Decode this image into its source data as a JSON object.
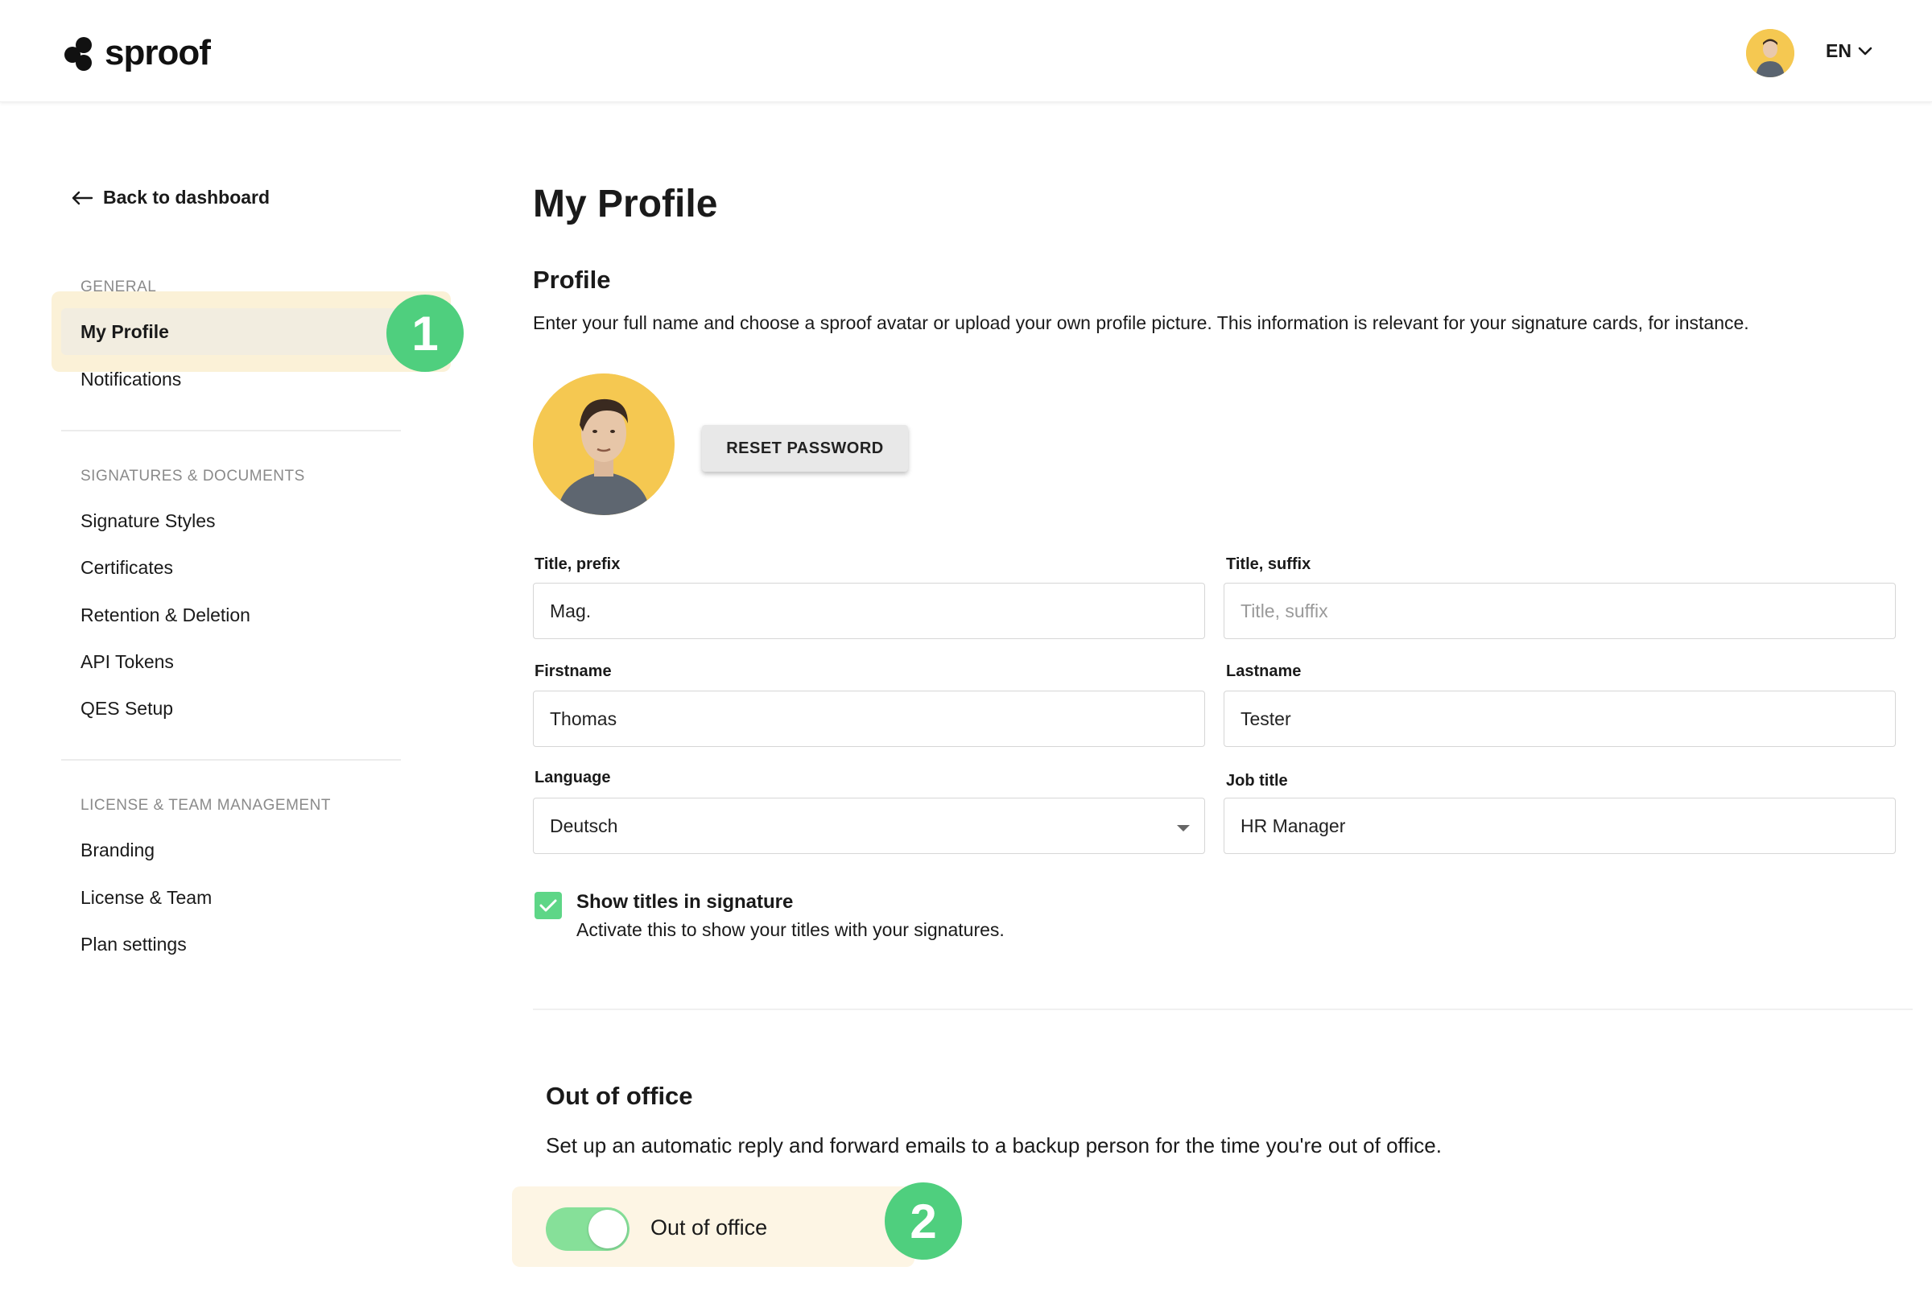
{
  "header": {
    "logo_text": "sproof",
    "language": "EN"
  },
  "sidebar": {
    "back_label": "Back to dashboard",
    "sections": [
      {
        "label": "GENERAL",
        "items": [
          "My Profile",
          "Notifications"
        ]
      },
      {
        "label": "SIGNATURES & DOCUMENTS",
        "items": [
          "Signature Styles",
          "Certificates",
          "Retention & Deletion",
          "API Tokens",
          "QES Setup"
        ]
      },
      {
        "label": "LICENSE & TEAM MANAGEMENT",
        "items": [
          "Branding",
          "License & Team",
          "Plan settings"
        ]
      }
    ],
    "active_item": "My Profile"
  },
  "badges": {
    "step1": "1",
    "step2": "2"
  },
  "main": {
    "page_title": "My Profile",
    "profile": {
      "heading": "Profile",
      "description": "Enter your full name and choose a sproof avatar or upload your own profile picture. This information is relevant for your signature cards, for instance.",
      "reset_password": "RESET PASSWORD"
    },
    "form": {
      "title_prefix": {
        "label": "Title, prefix",
        "value": "Mag.",
        "placeholder": "Title, prefix"
      },
      "title_suffix": {
        "label": "Title, suffix",
        "value": "",
        "placeholder": "Title, suffix"
      },
      "firstname": {
        "label": "Firstname",
        "value": "Thomas"
      },
      "lastname": {
        "label": "Lastname",
        "value": "Tester"
      },
      "language": {
        "label": "Language",
        "value": "Deutsch"
      },
      "job_title": {
        "label": "Job title",
        "value": "HR Manager"
      }
    },
    "show_titles": {
      "checked": true,
      "title": "Show titles in signature",
      "subtitle": "Activate this to show your titles with your signatures."
    },
    "out_of_office": {
      "heading": "Out of office",
      "description": "Set up an automatic reply and forward emails to a backup person for the time you're out of office.",
      "toggle_label": "Out of office",
      "enabled": true
    }
  },
  "colors": {
    "accent_green": "#4fcf7e",
    "highlight": "#fbf1d7",
    "avatar_bg": "#f5c851"
  }
}
